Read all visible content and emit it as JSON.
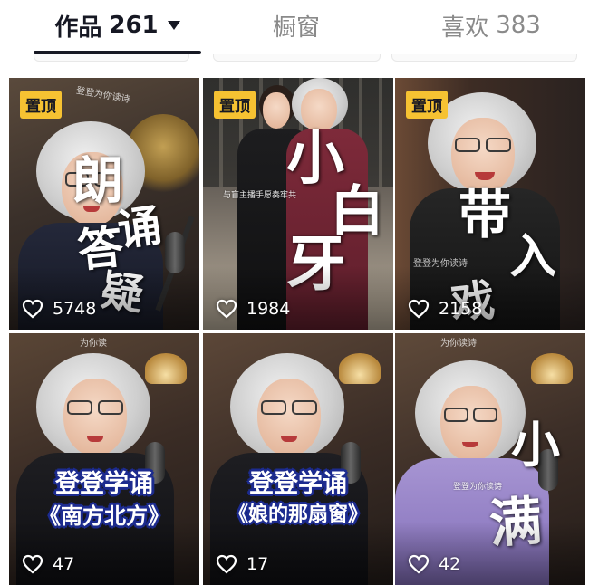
{
  "tabs": [
    {
      "label": "作品",
      "count": "261",
      "active": true
    },
    {
      "label": "橱窗",
      "count": "",
      "active": false
    },
    {
      "label": "喜欢",
      "count": "383",
      "active": false
    }
  ],
  "videos": [
    {
      "pinned": true,
      "pin_label": "置顶",
      "overlay_chars": [
        "朗",
        "诵",
        "答",
        "疑"
      ],
      "watermark": "登登为你读诗",
      "likes": "5748"
    },
    {
      "pinned": true,
      "pin_label": "置顶",
      "overlay_chars": [
        "小",
        "白",
        "牙"
      ],
      "caption": "与盲主播手愿奏牢共",
      "likes": "1984"
    },
    {
      "pinned": true,
      "pin_label": "置顶",
      "overlay_chars": [
        "带",
        "入",
        "戏"
      ],
      "watermark": "登登为你读诗",
      "likes": "2158"
    },
    {
      "pinned": false,
      "title_line1": "登登学诵",
      "title_line2": "《南方北方》",
      "watermark": "为你读",
      "likes": "47"
    },
    {
      "pinned": false,
      "title_line1": "登登学诵",
      "title_line2": "《娘的那扇窗》",
      "likes": "17"
    },
    {
      "pinned": false,
      "overlay_chars": [
        "小",
        "满"
      ],
      "watermark": "为你读诗",
      "caption": "登登为你读诗",
      "likes": "42"
    }
  ],
  "colors": {
    "active_tab": "#161823",
    "inactive_tab": "#8a8a8a",
    "pin_badge": "#f6c232",
    "title_outline": "#1c2b8f"
  },
  "icons": {
    "likes": "heart-outline-icon",
    "sort": "caret-down-icon"
  }
}
